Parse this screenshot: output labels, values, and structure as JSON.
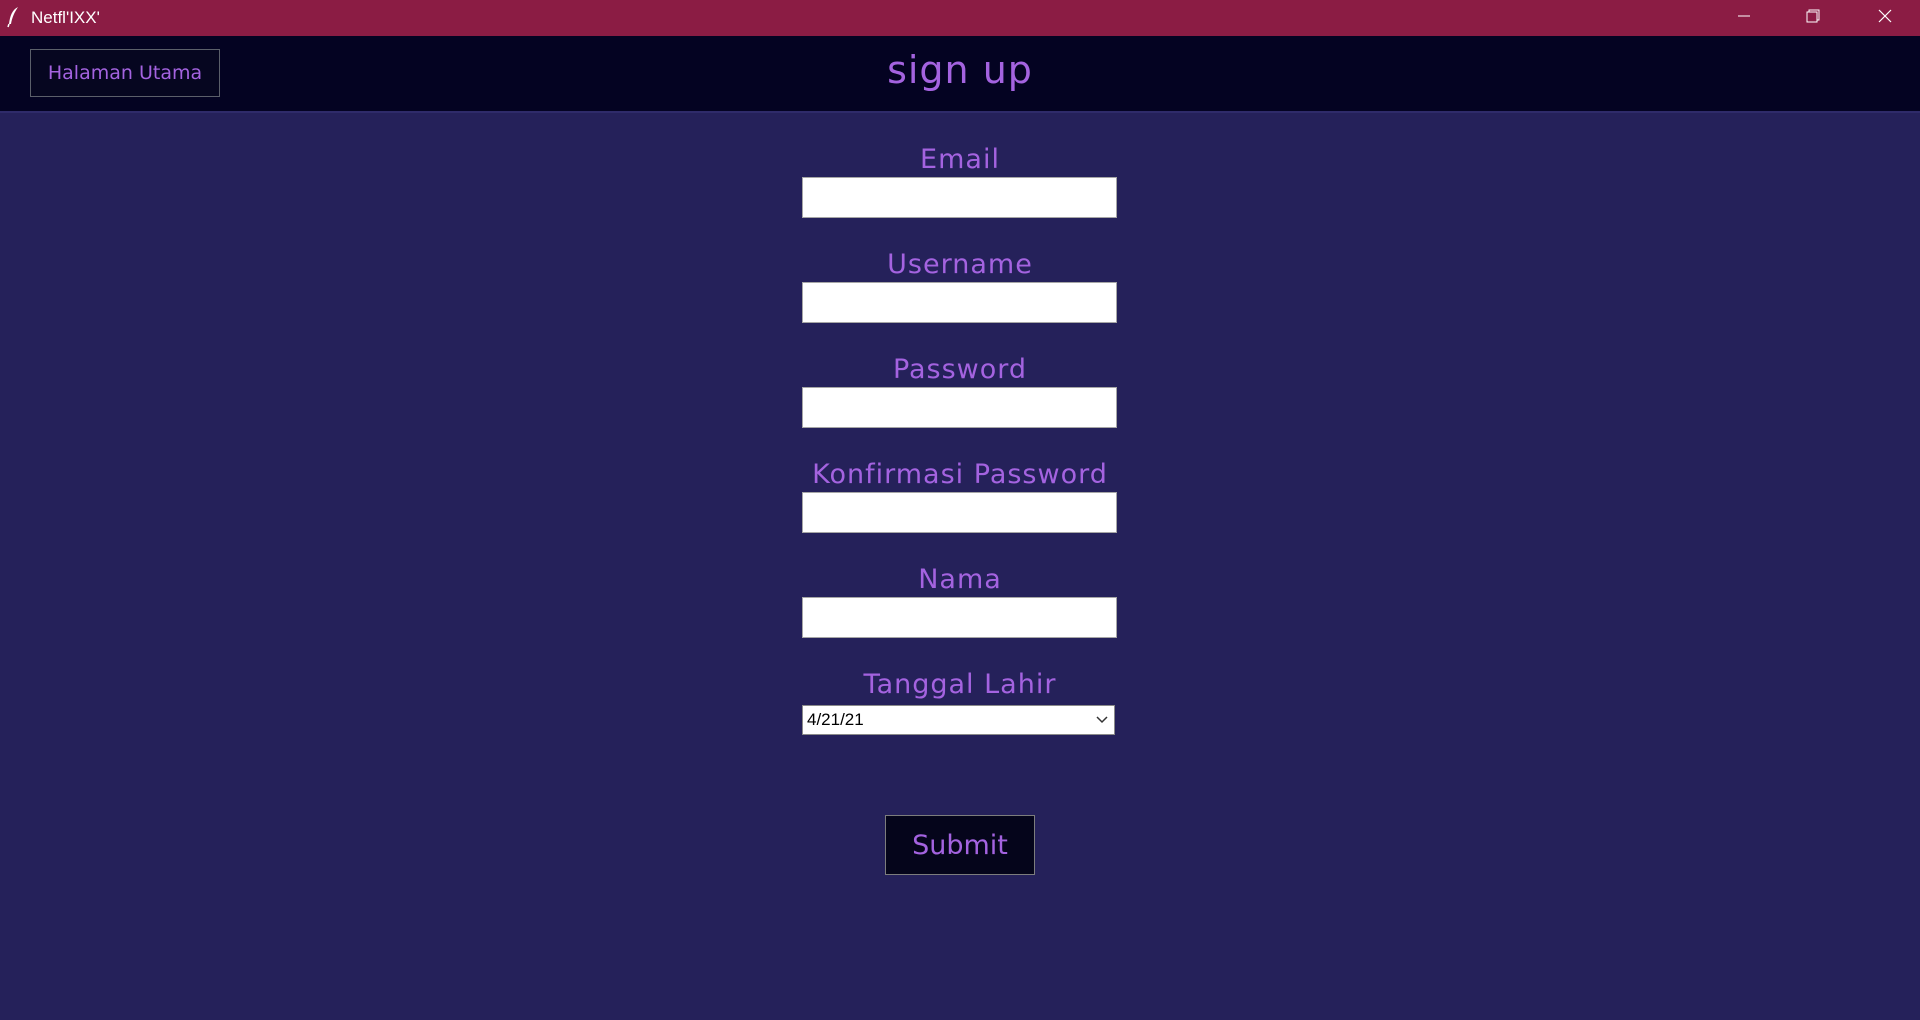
{
  "window": {
    "title": "Netfl'IXX'",
    "app_icon": "feather-icon",
    "controls": [
      "minimize-icon",
      "maximize-icon",
      "close-icon"
    ]
  },
  "header": {
    "home_button_label": "Halaman Utama",
    "page_title": "sign up"
  },
  "form": {
    "email_label": "Email",
    "email_value": "",
    "username_label": "Username",
    "username_value": "",
    "password_label": "Password",
    "password_value": "",
    "confirm_password_label": "Konfirmasi Password",
    "confirm_password_value": "",
    "name_label": "Nama",
    "name_value": "",
    "birthdate_label": "Tanggal Lahir",
    "birthdate_value": "4/21/21",
    "submit_label": "Submit"
  },
  "colors": {
    "titlebar": "#8b1c44",
    "header": "#040322",
    "background": "#25215a",
    "accent_text": "#a463e0"
  }
}
